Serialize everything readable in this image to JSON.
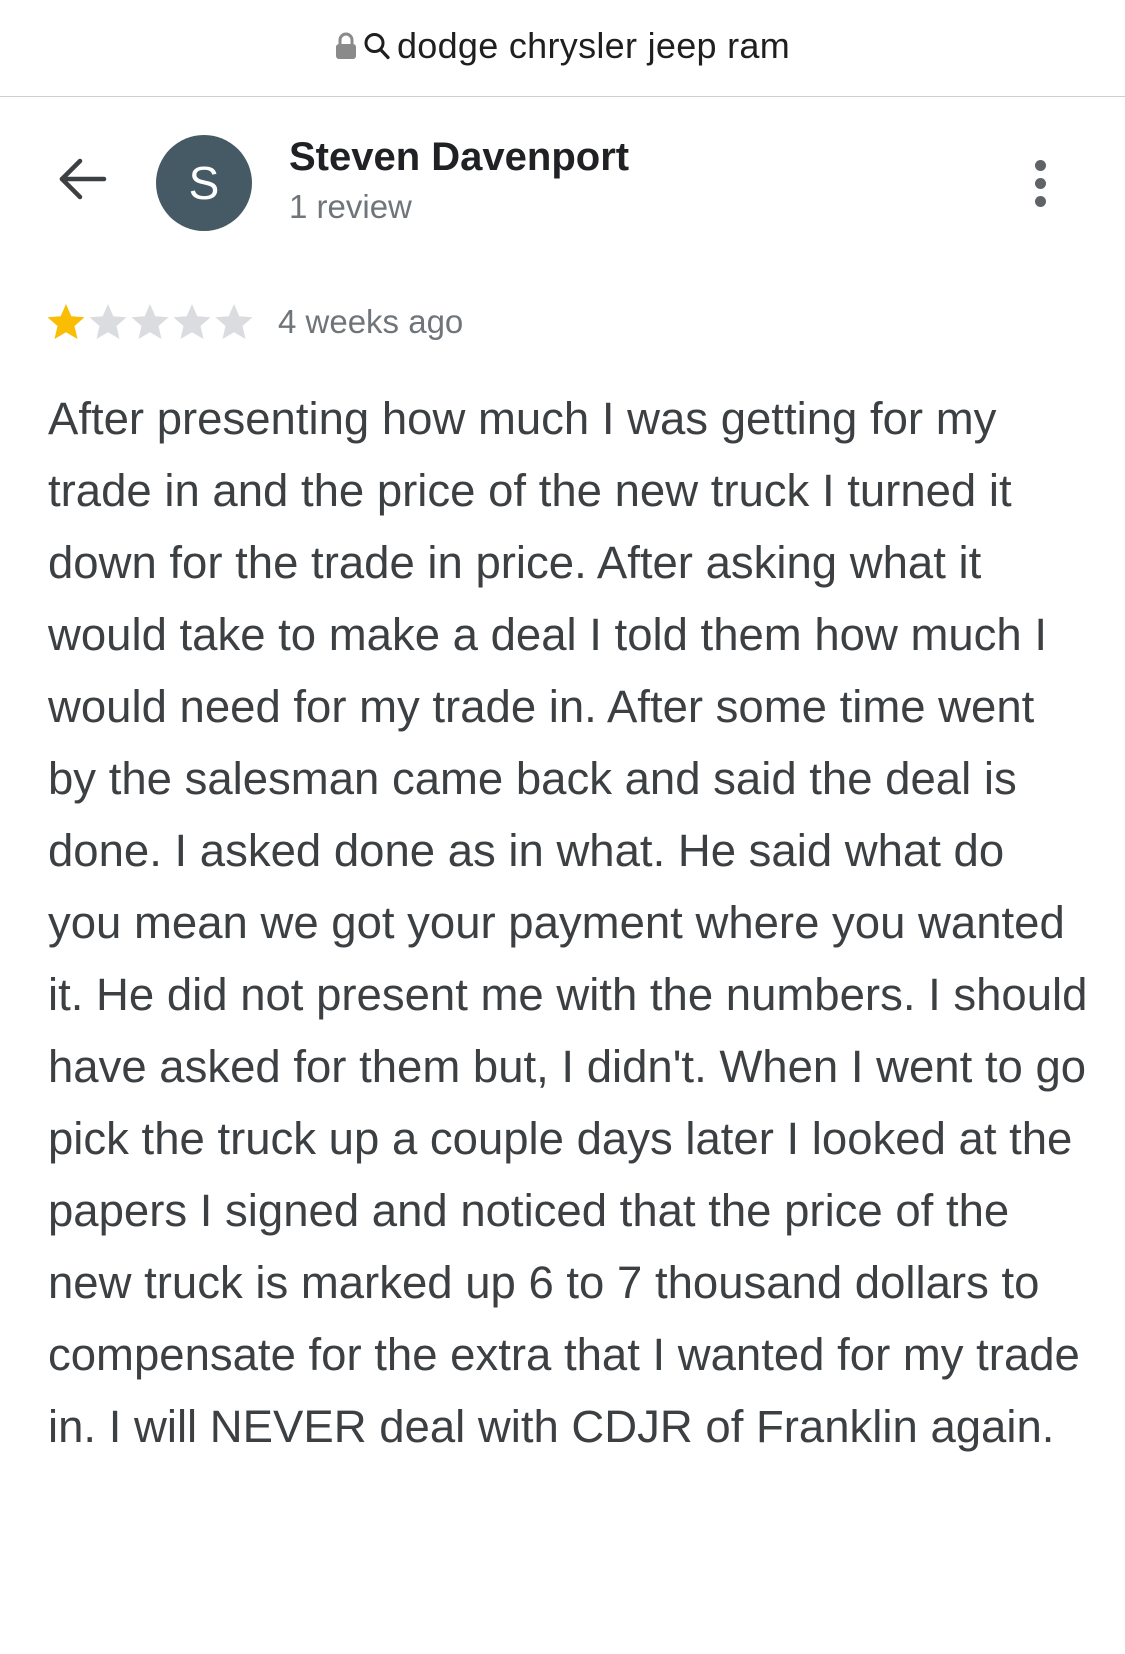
{
  "urlbar": {
    "lock_icon": "lock-icon",
    "search_icon": "search-icon",
    "text": "dodge chrysler jeep ram"
  },
  "header": {
    "back_icon": "arrow-back-icon",
    "avatar_letter": "S",
    "avatar_color": "#455a64",
    "name": "Steven Davenport",
    "review_count": "1 review",
    "more_icon": "more-vert-icon"
  },
  "review": {
    "rating": 1,
    "max_rating": 5,
    "star_filled_color": "#fbbc04",
    "star_empty_color": "#dadce0",
    "date": "4 weeks ago",
    "text": "After presenting how much I was getting for my trade in and the price of the new truck I turned it down for the trade in price. After asking what it would take to make a deal I told them how much I would need for my trade in. After some time went by the salesman came back and said the deal is done. I asked done as in what. He said what do you mean we got your payment where you wanted it. He did not present me with the numbers. I should have asked for them but, I didn't. When I went to go pick the truck up a couple days later I looked at the papers I signed and noticed that the price of the new truck is marked up 6 to 7 thousand dollars to compensate for the extra that I wanted for my trade in. I will NEVER deal with CDJR of Franklin again."
  }
}
